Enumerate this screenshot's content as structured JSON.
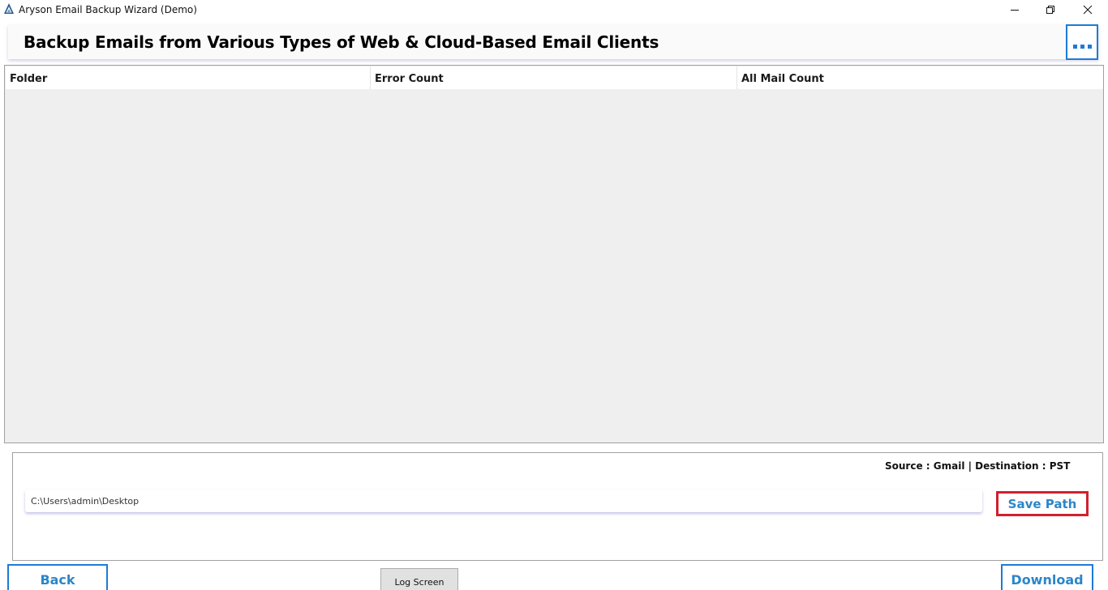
{
  "window": {
    "title": "Aryson Email Backup Wizard (Demo)",
    "icon": "aryson-logo-icon",
    "controls": [
      "minimize-icon",
      "restore-icon",
      "close-icon"
    ]
  },
  "header": {
    "title": "Backup Emails from Various Types of Web & Cloud-Based Email Clients",
    "more_icon": "ellipsis-icon"
  },
  "table": {
    "columns": [
      "Folder",
      "Error Count",
      "All Mail Count"
    ],
    "rows": []
  },
  "bottom": {
    "source_info": "Source : Gmail | Destination : PST",
    "path_value": "C:\\Users\\admin\\Desktop",
    "save_path_label": "Save Path"
  },
  "footer": {
    "back_label": "Back",
    "log_label": "Log Screen",
    "download_label": "Download"
  },
  "colors": {
    "accent": "#1d7bd6",
    "button_text": "#2b86c9",
    "highlight": "#d1202e",
    "table_bg": "#efefef"
  }
}
